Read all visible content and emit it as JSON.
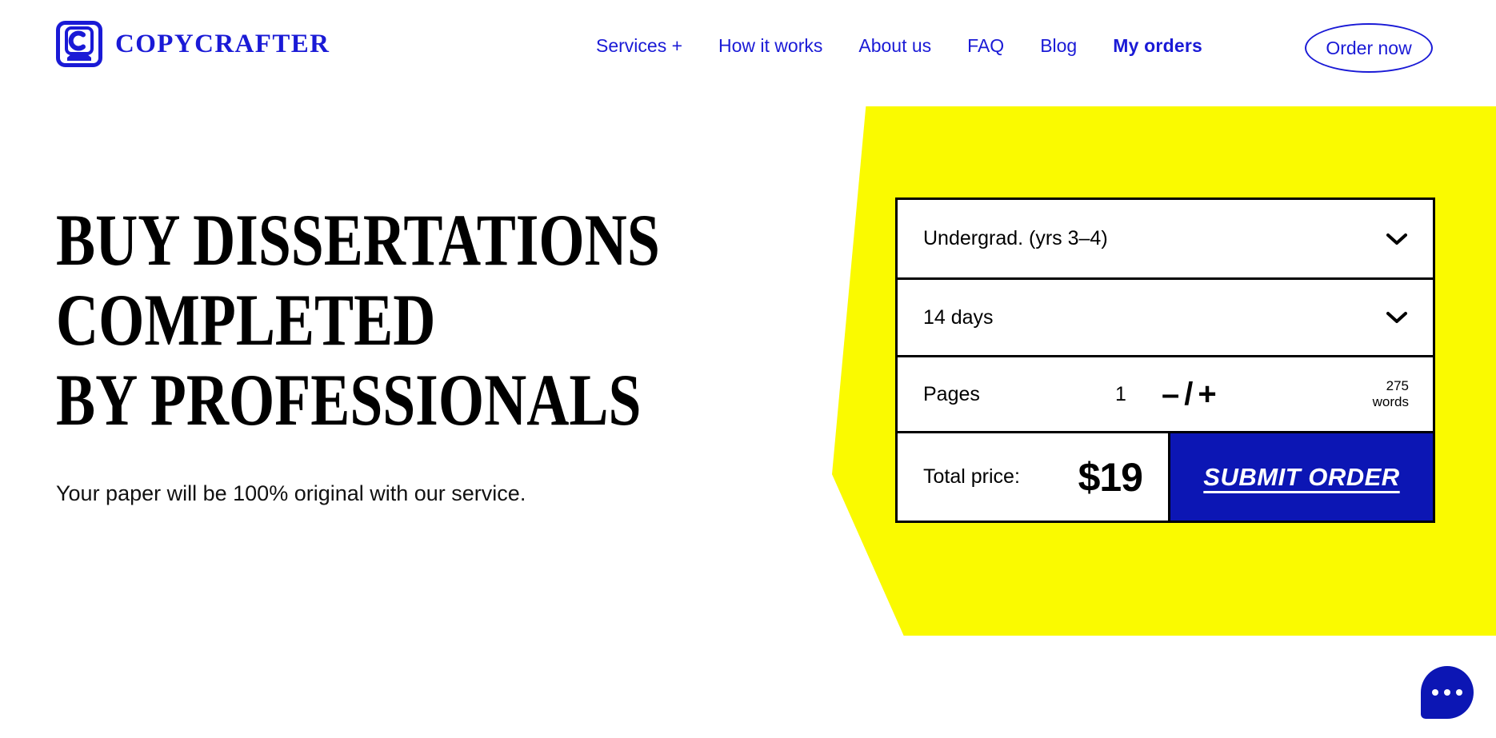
{
  "brand": {
    "name": "COPYCRAFTER",
    "logo_icon": "keyboard-key-c-icon",
    "color": "#1a1ad6"
  },
  "nav": {
    "items": [
      {
        "label": "Services +",
        "bold": false
      },
      {
        "label": "How it works",
        "bold": false
      },
      {
        "label": "About us",
        "bold": false
      },
      {
        "label": "FAQ",
        "bold": false
      },
      {
        "label": "Blog",
        "bold": false
      },
      {
        "label": "My orders",
        "bold": true
      }
    ],
    "cta": {
      "label": "Order now"
    }
  },
  "hero": {
    "title": "BUY DISSERTATIONS\nCOMPLETED\nBY PROFESSIONALS",
    "subtitle": "Your paper will be 100% original with our service."
  },
  "order_form": {
    "academic_level": {
      "value": "Undergrad. (yrs 3–4)",
      "icon": "chevron-down-icon"
    },
    "deadline": {
      "value": "14 days",
      "icon": "chevron-down-icon"
    },
    "pages": {
      "label": "Pages",
      "count": "1",
      "stepper_minus": "–",
      "stepper_divider": "/",
      "stepper_plus": "+",
      "words_count": "275",
      "words_label": "words"
    },
    "total": {
      "label": "Total price:",
      "price": "$19"
    },
    "submit": {
      "label": "SUBMIT ORDER"
    }
  },
  "chat": {
    "icon": "chat-bubble-ellipsis-icon"
  },
  "colors": {
    "brand_blue": "#1a1ad6",
    "button_blue": "#0c16b4",
    "accent_yellow": "#fafa00",
    "black": "#000000"
  }
}
